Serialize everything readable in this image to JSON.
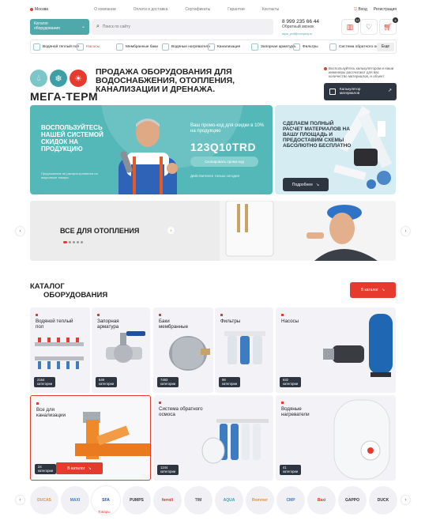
{
  "topbar": {
    "city": "Москва",
    "nav": [
      "О компании",
      "Оплата и доставка",
      "Сертификаты",
      "Гарантии",
      "Контакты"
    ],
    "login": "Вход",
    "register": "Регистрация"
  },
  "header": {
    "catalog_button": "Каталог оборудования",
    "search_placeholder": "Поиск по сайту",
    "phone": "8 999 235 66 44",
    "callback": "Обратный звонок",
    "email": "aqua_profi@company.ru",
    "compare_count": "12",
    "cart_count": "4"
  },
  "categories": [
    "Водяной теплый пол",
    "Насосы",
    "Мембранные баки",
    "Водяные нагреватели",
    "Канализация",
    "Запорная арматура",
    "Фильтры",
    "Система обратного осмоса"
  ],
  "categories_more": "Еще",
  "brand": {
    "name": "МЕГА-ТЕРМ",
    "tagline": "ПРОДАЖА ОБОРУДОВАНИЯ ДЛЯ ВОДОСНАБЖЕНИЯ, ОТОПЛЕНИЯ, КАНАЛИЗАЦИИ И ДРЕНАЖА.",
    "notice": "Воспользуйтесь калькулятором и наши инженеры рассчитают для вас количество материалов, и объект",
    "calculator": "Калькулятор материалов"
  },
  "promo": {
    "title": "ВОСПОЛЬЗУЙТЕСЬ НАШЕЙ СИСТЕМОЙ СКИДОК НА ПРОДУКЦИЮ",
    "small": "Предложение не распространяется на акционные товары",
    "code_label": "Ваш промо-код для скидки в 10% на продукцию",
    "code": "123Q10TRD",
    "copy": "Скопировать промо-код",
    "valid": "Действителен только сегодня"
  },
  "calc_promo": {
    "title": "СДЕЛАЕМ ПОЛНЫЙ РАСЧЕТ МАТЕРИАЛОВ НА ВАШУ ПЛОЩАДЬ И ПРЕДОСТАВИМ СХЕМЫ АБСОЛЮТНО БЕСПЛАТНО",
    "more": "Подробнее"
  },
  "slider": {
    "title": "ВСЕ ДЛЯ ОТОПЛЕНИЯ"
  },
  "catalog": {
    "title_line1": "КАТАЛОГ",
    "title_line2": "ОБОРУДОВАНИЯ",
    "button": "В каталог",
    "count_label": "категории",
    "cards": [
      {
        "name": "Водяной теплый пол",
        "count": "2164"
      },
      {
        "name": "Запорная арматура",
        "count": "649"
      },
      {
        "name": "Баки мембранные",
        "count": "7483"
      },
      {
        "name": "Фильтры",
        "count": "98"
      },
      {
        "name": "Насосы",
        "count": "632"
      },
      {
        "name": "Все для канализации",
        "count": "24"
      },
      {
        "name": "Система обратного осмоса",
        "count": "1244"
      },
      {
        "name": "Водяные нагреватели",
        "count": "41"
      }
    ],
    "card_button": "В каталог"
  },
  "brands": [
    "DUCAS",
    "MAXI",
    "SFA",
    "PUMPS",
    "ferroli",
    "TIM",
    "AQUA",
    "Rommer",
    "CMP",
    "Baxi",
    "GAPPO",
    "DUCK"
  ],
  "brand_tooltip": "Товары",
  "colors": {
    "accent": "#e53a2d",
    "teal": "#55b8b8",
    "dark": "#2d3541"
  }
}
